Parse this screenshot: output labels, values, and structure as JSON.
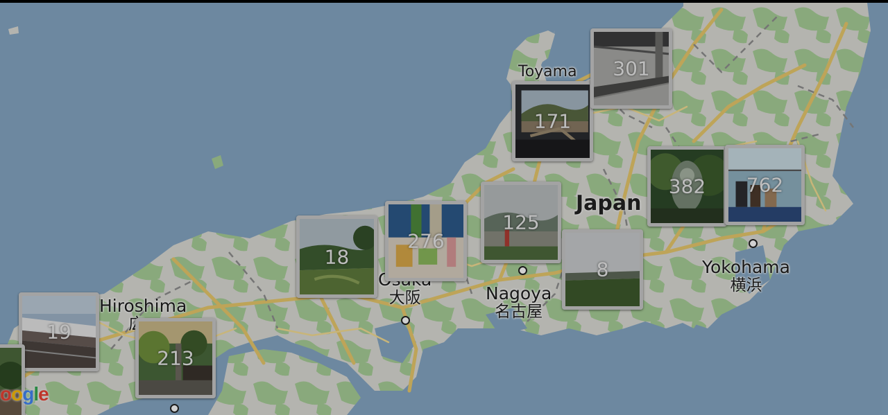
{
  "map": {
    "country": "Japan",
    "cities": [
      {
        "id": "hiroshima",
        "name": "Hiroshima",
        "jp": "広"
      },
      {
        "id": "osaka",
        "name": "Osaka",
        "jp": "大阪"
      },
      {
        "id": "nagoya",
        "name": "Nagoya",
        "jp": "名古屋"
      },
      {
        "id": "yokohama",
        "name": "Yokohama",
        "jp": "横浜"
      },
      {
        "id": "toyama",
        "name": "Toyama",
        "jp": ""
      }
    ],
    "logo_letters": [
      "o",
      "g",
      "l",
      "e"
    ],
    "logo_colors": [
      "#ea4335",
      "#4285f4",
      "#34a853",
      "#ea4335"
    ]
  },
  "clusters": [
    {
      "id": "19",
      "count": "19",
      "photo": "train-platform"
    },
    {
      "id": "213",
      "count": "213",
      "photo": "shrine-garden"
    },
    {
      "id": "18",
      "count": "18",
      "photo": "garden-park"
    },
    {
      "id": "276",
      "count": "276",
      "photo": "food-bento"
    },
    {
      "id": "125",
      "count": "125",
      "photo": "cloudy-valley"
    },
    {
      "id": "8",
      "count": "8",
      "photo": "field-sky"
    },
    {
      "id": "171",
      "count": "171",
      "photo": "mountain-town"
    },
    {
      "id": "301",
      "count": "301",
      "photo": "station-roof"
    },
    {
      "id": "382",
      "count": "382",
      "photo": "forest-statue"
    },
    {
      "id": "762",
      "count": "762",
      "photo": "airport-hall"
    }
  ],
  "colors": {
    "water": "#86a7c4",
    "land": "#dcdcd6",
    "park": "#a5cc96",
    "road": "#e8c86c",
    "border": "#c7c7c7"
  }
}
